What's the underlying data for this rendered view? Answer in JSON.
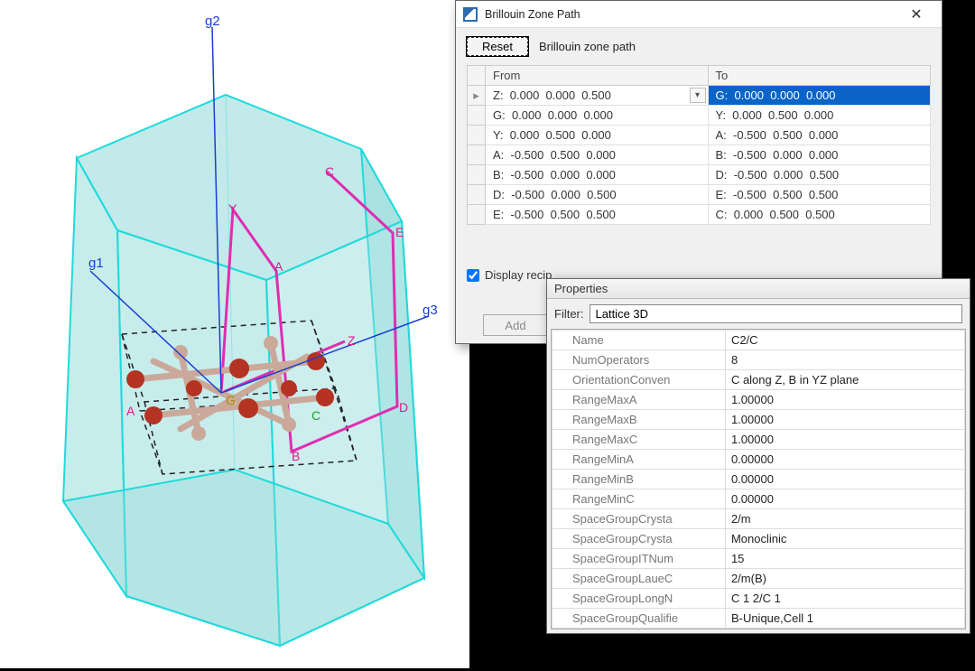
{
  "bz_dialog": {
    "title": "Brillouin Zone Path",
    "reset_label": "Reset",
    "section_label": "Brillouin zone path",
    "columns": {
      "from": "From",
      "to": "To"
    },
    "rows": [
      {
        "from": "Z:  0.000  0.000  0.500",
        "to": "G:  0.000  0.000  0.000",
        "selected": true
      },
      {
        "from": "G:  0.000  0.000  0.000",
        "to": "Y:  0.000  0.500  0.000"
      },
      {
        "from": "Y:  0.000  0.500  0.000",
        "to": "A:  -0.500  0.500  0.000"
      },
      {
        "from": "A:  -0.500  0.500  0.000",
        "to": "B:  -0.500  0.000  0.000"
      },
      {
        "from": "B:  -0.500  0.000  0.000",
        "to": "D:  -0.500  0.000  0.500"
      },
      {
        "from": "D:  -0.500  0.000  0.500",
        "to": "E:  -0.500  0.500  0.500"
      },
      {
        "from": "E:  -0.500  0.500  0.500",
        "to": "C:  0.000  0.500  0.500"
      }
    ],
    "display_recip_label": "Display recip",
    "display_recip_checked": true,
    "add_label": "Add"
  },
  "props_panel": {
    "title": "Properties",
    "filter_label": "Filter:",
    "filter_value": "Lattice 3D",
    "rows": [
      {
        "key": "Name",
        "val": "C2/C"
      },
      {
        "key": "NumOperators",
        "val": "8"
      },
      {
        "key": "OrientationConven",
        "val": "C along Z, B in YZ plane"
      },
      {
        "key": "RangeMaxA",
        "val": "1.00000"
      },
      {
        "key": "RangeMaxB",
        "val": "1.00000"
      },
      {
        "key": "RangeMaxC",
        "val": "1.00000"
      },
      {
        "key": "RangeMinA",
        "val": "0.00000"
      },
      {
        "key": "RangeMinB",
        "val": "0.00000"
      },
      {
        "key": "RangeMinC",
        "val": "0.00000"
      },
      {
        "key": "SpaceGroupCrysta",
        "val": "2/m"
      },
      {
        "key": "SpaceGroupCrysta",
        "val": "Monoclinic"
      },
      {
        "key": "SpaceGroupITNum",
        "val": "15"
      },
      {
        "key": "SpaceGroupLaueC",
        "val": "2/m(B)"
      },
      {
        "key": "SpaceGroupLongN",
        "val": "C 1 2/C 1"
      },
      {
        "key": "SpaceGroupQualifie",
        "val": "B-Unique,Cell 1"
      }
    ]
  },
  "bz_scene": {
    "axis_labels": {
      "g1": "g1",
      "g2": "g2",
      "g3": "g3"
    },
    "kpoint_labels": [
      "G",
      "Z",
      "Y",
      "A",
      "B",
      "C",
      "D",
      "E"
    ]
  }
}
